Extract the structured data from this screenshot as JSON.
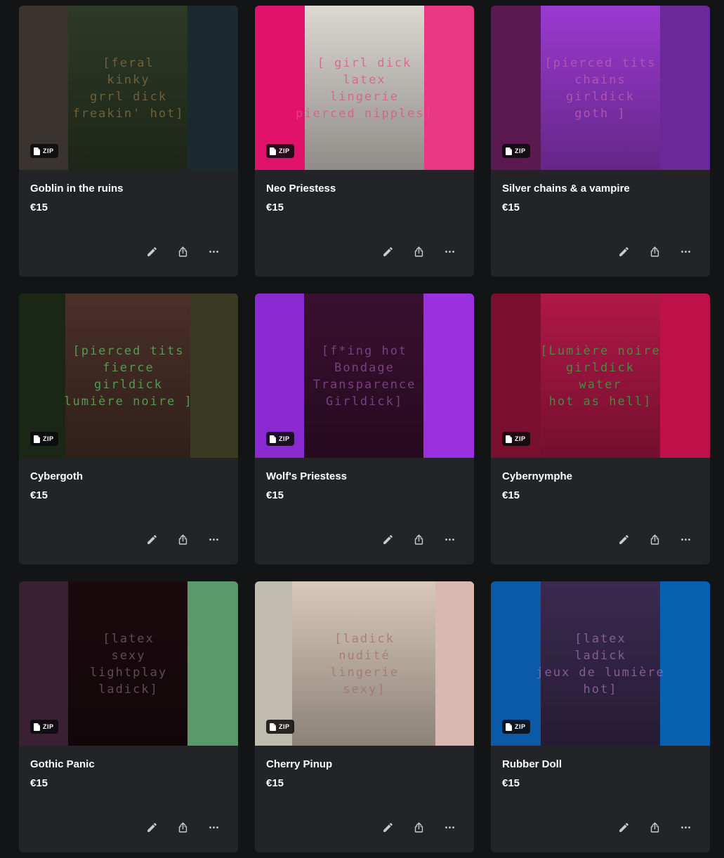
{
  "products": [
    {
      "title": "Goblin in the ruins",
      "price": "€15",
      "badge": "ZIP",
      "overlay_text": "[feral\nkinky\ngrrl dick\nfreakin' hot]",
      "colors": {
        "left": "#3a3430",
        "photo": "#2d3a26",
        "right": "#1a2a30",
        "overlay": "#8a7040"
      }
    },
    {
      "title": "Neo Priestess",
      "price": "€15",
      "badge": "ZIP",
      "overlay_text": "[  girl dick\nlatex\nlingerie\npierced nipples]",
      "colors": {
        "left": "#e0126a",
        "photo": "#dcd8d2",
        "right": "#e83884",
        "overlay": "#e0508a"
      }
    },
    {
      "title": "Silver chains & a vampire",
      "price": "€15",
      "badge": "ZIP",
      "overlay_text": "[pierced tits\nchains\ngirldick\ngoth ]",
      "colors": {
        "left": "#5a1a50",
        "photo": "#9a3ad0",
        "right": "#6a2898",
        "overlay": "#c060b0"
      }
    },
    {
      "title": "Cybergoth",
      "price": "€15",
      "badge": "ZIP",
      "overlay_text": "[pierced tits\nfierce\ngirldick\nlumière noire ]",
      "colors": {
        "left": "#1a2616",
        "photo": "#4a3028",
        "right": "#3a3a22",
        "overlay": "#5ac060"
      }
    },
    {
      "title": "Wolf's Priestess",
      "price": "€15",
      "badge": "ZIP",
      "overlay_text": "[f*ing hot\nBondage\nTransparence\nGirldick]",
      "colors": {
        "left": "#8a2ad0",
        "photo": "#3a1030",
        "right": "#9a30e0",
        "overlay": "#9050a0"
      }
    },
    {
      "title": "Cybernymphe",
      "price": "€15",
      "badge": "ZIP",
      "overlay_text": "[Lumière noire\ngirldick\nwater\nhot as hell]",
      "colors": {
        "left": "#7a1030",
        "photo": "#b01848",
        "right": "#c0104a",
        "overlay": "#30b040"
      }
    },
    {
      "title": "Gothic Panic",
      "price": "€15",
      "badge": "ZIP",
      "overlay_text": "[latex\nsexy\nlightplay\nladick]",
      "colors": {
        "left": "#3a2030",
        "photo": "#1a0a0e",
        "right": "#5a9a68",
        "overlay": "#7a6070"
      }
    },
    {
      "title": "Cherry Pinup",
      "price": "€15",
      "badge": "ZIP",
      "overlay_text": "[ladick\nnudité\nlingerie\nsexy]",
      "colors": {
        "left": "#c0bcb0",
        "photo": "#d8c8b8",
        "right": "#d8b8b0",
        "overlay": "#a07070"
      }
    },
    {
      "title": "Rubber Doll",
      "price": "€15",
      "badge": "ZIP",
      "overlay_text": "[latex\nladick\njeux de lumière\nhot]",
      "colors": {
        "left": "#0a5aa8",
        "photo": "#3a2a50",
        "right": "#0a60b0",
        "overlay": "#a070b0"
      }
    }
  ],
  "actions": {
    "edit": "pencil-icon",
    "share": "share-icon",
    "more": "more-icon"
  }
}
